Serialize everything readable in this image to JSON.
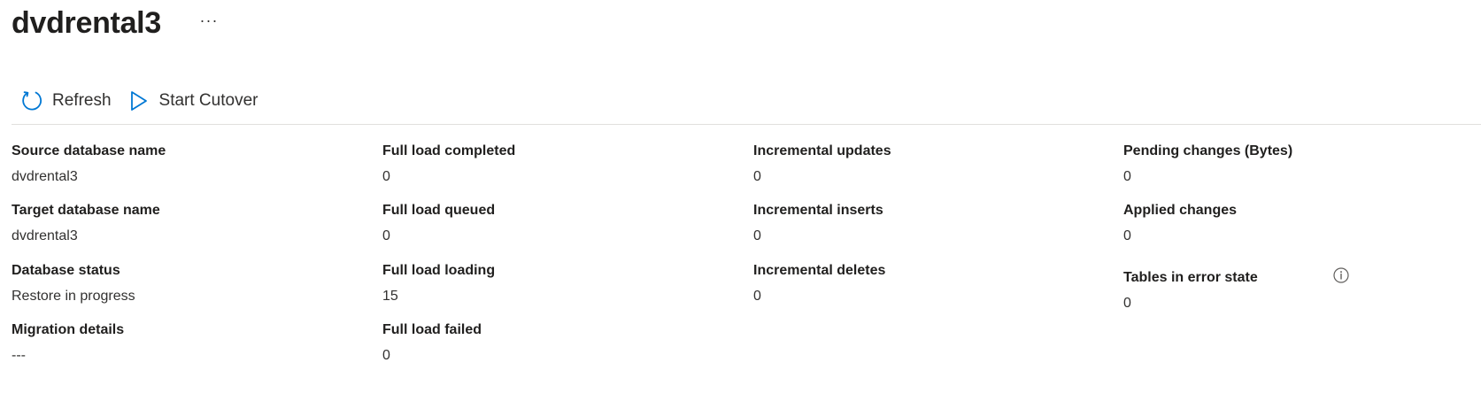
{
  "header": {
    "title": "dvdrental3",
    "more_label": "···"
  },
  "toolbar": {
    "refresh_label": "Refresh",
    "start_cutover_label": "Start Cutover"
  },
  "details": {
    "col1": [
      {
        "label": "Source database name",
        "value": "dvdrental3"
      },
      {
        "label": "Target database name",
        "value": "dvdrental3"
      },
      {
        "label": "Database status",
        "value": "Restore in progress"
      },
      {
        "label": "Migration details",
        "value": "---"
      }
    ],
    "col2": [
      {
        "label": "Full load completed",
        "value": "0"
      },
      {
        "label": "Full load queued",
        "value": "0"
      },
      {
        "label": "Full load loading",
        "value": "15"
      },
      {
        "label": "Full load failed",
        "value": "0"
      }
    ],
    "col3": [
      {
        "label": "Incremental updates",
        "value": "0"
      },
      {
        "label": "Incremental inserts",
        "value": "0"
      },
      {
        "label": "Incremental deletes",
        "value": "0"
      }
    ],
    "col4": [
      {
        "label": "Pending changes (Bytes)",
        "value": "0"
      },
      {
        "label": "Applied changes",
        "value": "0"
      },
      {
        "label": "Tables in error state",
        "value": "0"
      }
    ]
  },
  "icons": {
    "refresh": "refresh-icon",
    "play": "play-icon",
    "info": "info-icon",
    "more": "more-icon"
  },
  "colors": {
    "accent": "#0078d4",
    "text": "#323130",
    "divider": "#e1dfdd"
  }
}
